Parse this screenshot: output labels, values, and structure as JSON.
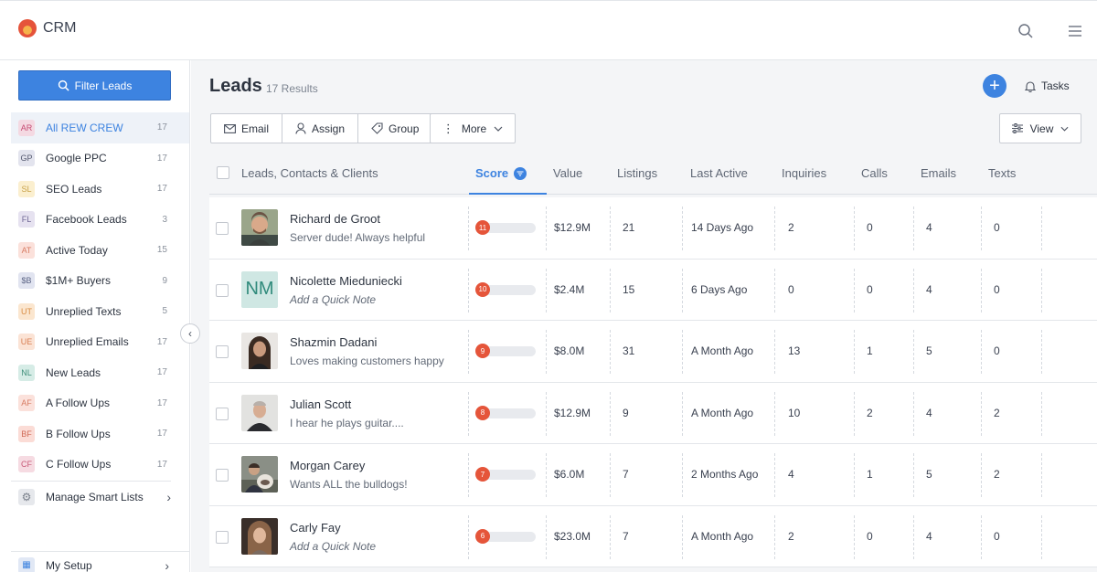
{
  "app": {
    "title": "CRM"
  },
  "sidebar": {
    "filter_label": "Filter Leads",
    "items": [
      {
        "abbr": "AR",
        "label": "All REW CREW",
        "count": "17",
        "bg": "#f4d9e2",
        "fg": "#c64a72",
        "active": true
      },
      {
        "abbr": "GP",
        "label": "Google PPC",
        "count": "17",
        "bg": "#e3e4ee",
        "fg": "#555a70"
      },
      {
        "abbr": "SL",
        "label": "SEO Leads",
        "count": "17",
        "bg": "#fbefcf",
        "fg": "#c9a24a"
      },
      {
        "abbr": "FL",
        "label": "Facebook Leads",
        "count": "3",
        "bg": "#e6e2f0",
        "fg": "#6f6795"
      },
      {
        "abbr": "AT",
        "label": "Active Today",
        "count": "15",
        "bg": "#fbe1db",
        "fg": "#d77c63"
      },
      {
        "abbr": "$B",
        "label": "$1M+ Buyers",
        "count": "9",
        "bg": "#e1e4f0",
        "fg": "#5c6485"
      },
      {
        "abbr": "UT",
        "label": "Unreplied Texts",
        "count": "5",
        "bg": "#fbe6cf",
        "fg": "#d98e45"
      },
      {
        "abbr": "UE",
        "label": "Unreplied Emails",
        "count": "17",
        "bg": "#fbe3d5",
        "fg": "#d98055"
      },
      {
        "abbr": "NL",
        "label": "New Leads",
        "count": "17",
        "bg": "#d6ece6",
        "fg": "#3f8f7a"
      },
      {
        "abbr": "AF",
        "label": "A Follow Ups",
        "count": "17",
        "bg": "#fbe1db",
        "fg": "#d77c63"
      },
      {
        "abbr": "BF",
        "label": "B Follow Ups",
        "count": "17",
        "bg": "#fbdcd6",
        "fg": "#cf6a56"
      },
      {
        "abbr": "CF",
        "label": "C Follow Ups",
        "count": "17",
        "bg": "#f6dbe2",
        "fg": "#c85a78"
      }
    ],
    "manage_label": "Manage Smart Lists",
    "setup_label": "My Setup"
  },
  "main": {
    "title": "Leads",
    "results": "17 Results",
    "tasks_label": "Tasks",
    "actions": {
      "email": "Email",
      "assign": "Assign",
      "group": "Group",
      "more": "More",
      "view": "View"
    },
    "columns": {
      "leads": "Leads, Contacts & Clients",
      "score": "Score",
      "value": "Value",
      "listings": "Listings",
      "last_active": "Last Active",
      "inquiries": "Inquiries",
      "calls": "Calls",
      "emails": "Emails",
      "texts": "Texts"
    },
    "rows": [
      {
        "name": "Richard de Groot",
        "note": "Server dude! Always helpful",
        "quick": false,
        "avatar": "photo",
        "score": "11",
        "value": "$12.9M",
        "listings": "21",
        "last_active": "14 Days Ago",
        "inquiries": "2",
        "calls": "0",
        "emails": "4",
        "texts": "0"
      },
      {
        "name": "Nicolette Mieduniecki",
        "note": "Add a Quick Note",
        "quick": true,
        "avatar": "NM",
        "score": "10",
        "value": "$2.4M",
        "listings": "15",
        "last_active": "6 Days Ago",
        "inquiries": "0",
        "calls": "0",
        "emails": "4",
        "texts": "0"
      },
      {
        "name": "Shazmin Dadani",
        "note": "Loves making customers happy",
        "quick": false,
        "avatar": "photo",
        "score": "9",
        "value": "$8.0M",
        "listings": "31",
        "last_active": "A Month Ago",
        "inquiries": "13",
        "calls": "1",
        "emails": "5",
        "texts": "0"
      },
      {
        "name": "Julian Scott",
        "note": "I hear he plays guitar....",
        "quick": false,
        "avatar": "photo",
        "score": "8",
        "value": "$12.9M",
        "listings": "9",
        "last_active": "A Month Ago",
        "inquiries": "10",
        "calls": "2",
        "emails": "4",
        "texts": "2"
      },
      {
        "name": "Morgan Carey",
        "note": "Wants ALL the bulldogs!",
        "quick": false,
        "avatar": "photo",
        "score": "7",
        "value": "$6.0M",
        "listings": "7",
        "last_active": "2 Months Ago",
        "inquiries": "4",
        "calls": "1",
        "emails": "5",
        "texts": "2"
      },
      {
        "name": "Carly Fay",
        "note": "Add a Quick Note",
        "quick": true,
        "avatar": "photo",
        "score": "6",
        "value": "$23.0M",
        "listings": "7",
        "last_active": "A Month Ago",
        "inquiries": "2",
        "calls": "0",
        "emails": "4",
        "texts": "0"
      }
    ]
  },
  "colors": {
    "accent": "#3d83e0",
    "score": "#e5553a",
    "brand": "#e5533a"
  },
  "icons": [
    "flame-logo-icon",
    "search-icon",
    "hamburger-menu-icon",
    "plus-icon",
    "bell-icon",
    "envelope-icon",
    "user-icon",
    "tag-icon",
    "more-vertical-icon",
    "chevron-down-icon",
    "sliders-icon",
    "filter-icon",
    "gear-icon",
    "chevron-right-icon",
    "chevron-left-icon",
    "grid-icon"
  ]
}
